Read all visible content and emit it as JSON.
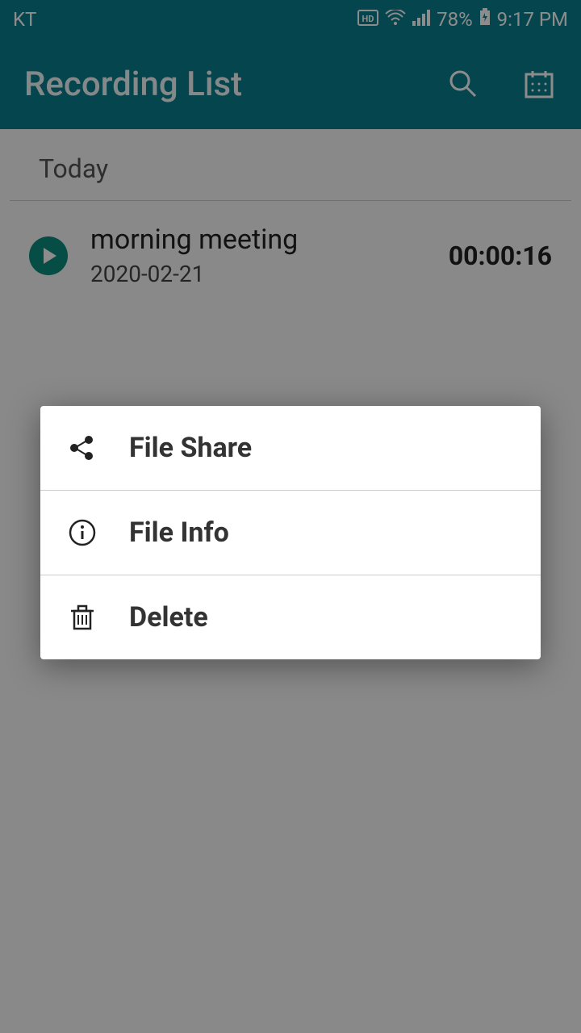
{
  "status": {
    "carrier": "KT",
    "battery": "78%",
    "time": "9:17 PM"
  },
  "appbar": {
    "title": "Recording List"
  },
  "section": {
    "header": "Today"
  },
  "recording": {
    "title": "morning meeting",
    "date": "2020-02-21",
    "duration": "00:00:16"
  },
  "dialog": {
    "share": "File Share",
    "info": "File Info",
    "delete": "Delete"
  }
}
